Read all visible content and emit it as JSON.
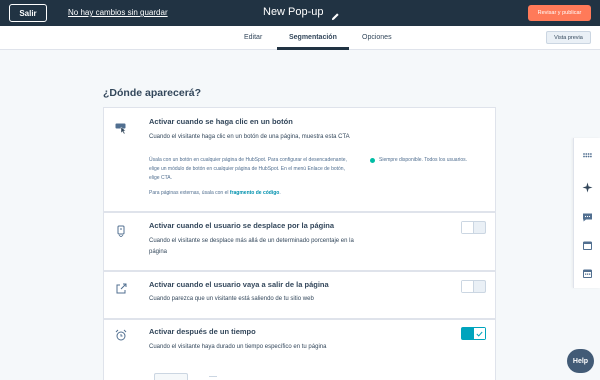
{
  "header": {
    "exit_label": "Salir",
    "unsaved_label": "No hay cambios sin guardar",
    "title": "New Pop-up",
    "publish_label": "Revisar y publicar"
  },
  "tabs": [
    {
      "label": "Editar",
      "active": false
    },
    {
      "label": "Segmentación",
      "active": true
    },
    {
      "label": "Opciones",
      "active": false
    }
  ],
  "preview_label": "Vista previa",
  "main": {
    "heading": "¿Dónde aparecerá?",
    "options": [
      {
        "icon": "cursor-click-icon",
        "title": "Activar cuando se haga clic en un botón",
        "description": "Cuando el visitante haga clic en un botón de una página, muestra esta CTA",
        "note": "Úsala con un botón en cualquier página de HubSpot. Para configurar el desencadenante, elige un módulo de botón en cualquier página de HubSpot. En el menú Enlace de botón, elige CTA.",
        "external_prefix": "Para páginas externas, úsala con el",
        "external_link": "fragmento de código",
        "external_suffix": ".",
        "status": "Siempre disponible. Todos los usuarios."
      },
      {
        "icon": "scroll-icon",
        "title": "Activar cuando el usuario se desplace por la página",
        "description": "Cuando el visitante se desplace más allá de un determinado porcentaje en la página",
        "enabled": false
      },
      {
        "icon": "exit-icon",
        "title": "Activar cuando el usuario vaya a salir de la página",
        "description": "Cuando parezca que un visitante está saliendo de tu sitio web",
        "enabled": false
      },
      {
        "icon": "alarm-clock-icon",
        "title": "Activar después de un tiempo",
        "description": "Cuando el visitante haya durado un tiempo específico en tu página",
        "enabled": true
      }
    ]
  },
  "side_icons": [
    "grid-dots-icon",
    "sparkle-icon",
    "chat-icon",
    "calendar-icon",
    "calendar-alt-icon"
  ],
  "help_label": "Help",
  "colors": {
    "topbar": "#213343",
    "accent": "#ff7a59",
    "toggle_on": "#00a4bd",
    "status_ok": "#00bda5",
    "link": "#0091ae"
  }
}
